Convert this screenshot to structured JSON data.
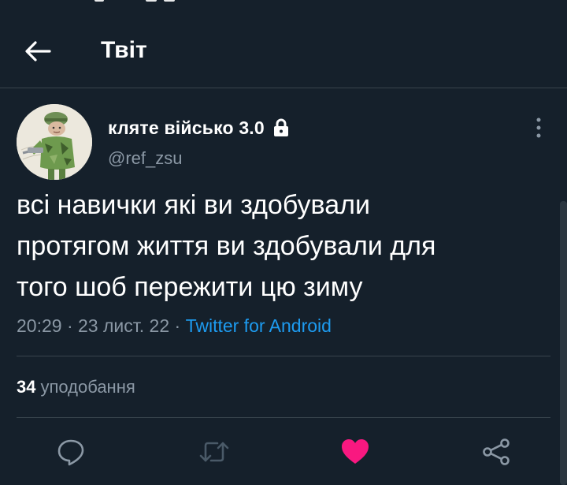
{
  "header": {
    "title": "Твіт"
  },
  "tweet": {
    "author_name": "кляте військо 3.0",
    "author_handle": "@ref_zsu",
    "text": "всі навички які ви здобували\nпротягом життя ви здобували для\nтого шоб пережити цю зиму",
    "time": "20:29",
    "separator": "·",
    "date": "23 лист. 22",
    "source": "Twitter for Android"
  },
  "stats": {
    "likes_count": "34",
    "likes_label": "уподобання"
  },
  "colors": {
    "background": "#15202b",
    "accent": "#1d9bf0",
    "like_active": "#f91880",
    "secondary_text": "#8b98a5",
    "divider": "#38444d"
  },
  "icons": {
    "back": "arrow-left-icon",
    "lock": "lock-icon",
    "more": "more-vertical-icon",
    "reply": "reply-icon",
    "retweet": "retweet-icon",
    "like": "heart-filled-icon",
    "share": "share-icon"
  }
}
